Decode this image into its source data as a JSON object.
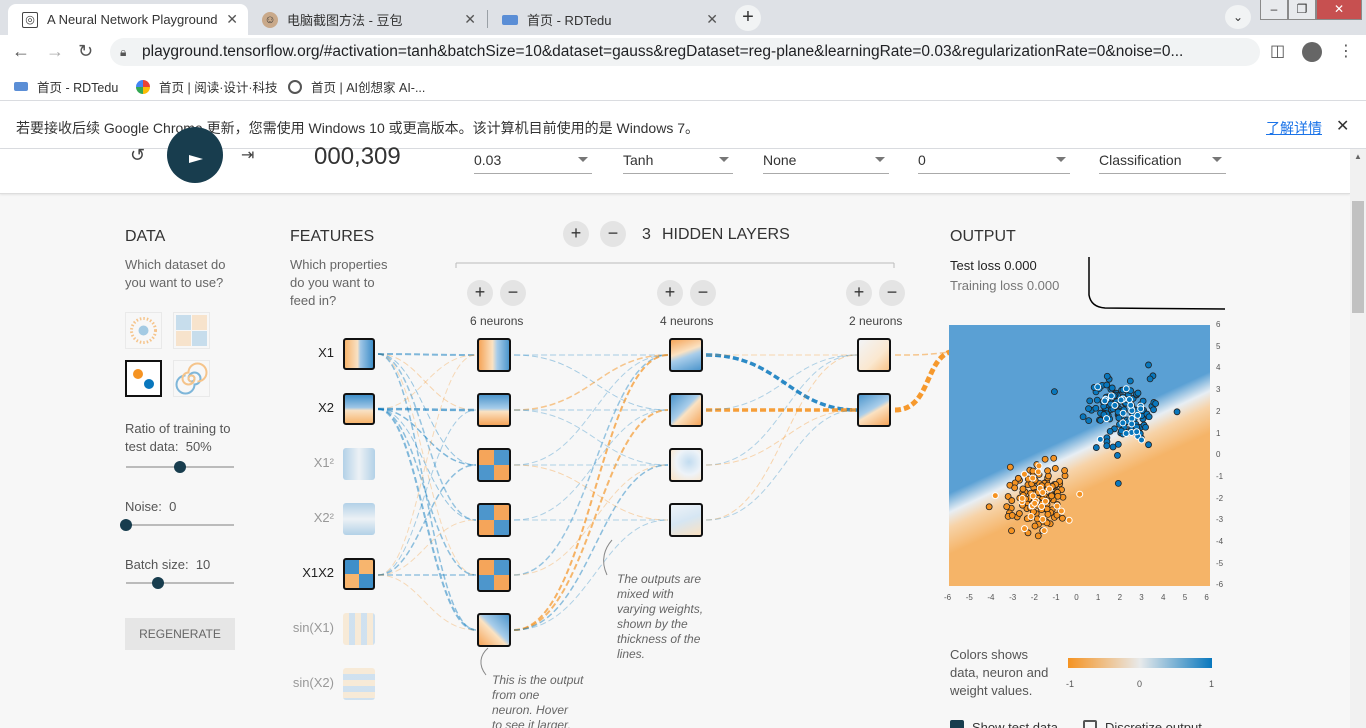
{
  "browser": {
    "tabs": [
      {
        "title": "A Neural Network Playground",
        "active": true
      },
      {
        "title": "电脑截图方法 - 豆包",
        "active": false
      },
      {
        "title": "首页 - RDTedu",
        "active": false
      }
    ],
    "url": "playground.tensorflow.org/#activation=tanh&batchSize=10&dataset=gauss&regDataset=reg-plane&learningRate=0.03&regularizationRate=0&noise=0...",
    "bookmarks": [
      "首页 - RDTedu",
      "首页 | 阅读·设计·科技",
      "首页 | AI创想家 AI-..."
    ],
    "infobar_text": "若要接收后续 Google Chrome 更新，您需使用 Windows 10 或更高版本。该计算机目前使用的是 Windows 7。",
    "infobar_link": "了解详情"
  },
  "top": {
    "epoch": "000,309",
    "learning_rate": "0.03",
    "activation": "Tanh",
    "regularization": "None",
    "reg_rate": "0",
    "problem_type": "Classification"
  },
  "data_panel": {
    "title": "DATA",
    "subtitle": "Which dataset do you want to use?",
    "ratio_label": "Ratio of training to test data:",
    "ratio_value": "50%",
    "ratio_fraction": 0.5,
    "noise_label": "Noise:",
    "noise_value": "0",
    "noise_fraction": 0,
    "batch_label": "Batch size:",
    "batch_value": "10",
    "batch_fraction": 0.3,
    "regenerate": "REGENERATE"
  },
  "features_panel": {
    "title": "FEATURES",
    "subtitle": "Which properties do you want to feed in?",
    "features": [
      {
        "label": "X1",
        "active": true
      },
      {
        "label": "X2",
        "active": true
      },
      {
        "label": "X1²",
        "active": false
      },
      {
        "label": "X2²",
        "active": false
      },
      {
        "label": "X1X2",
        "active": true
      },
      {
        "label": "sin(X1)",
        "active": false
      },
      {
        "label": "sin(X2)",
        "active": false
      }
    ]
  },
  "network": {
    "hidden_count": "3",
    "hidden_label": "HIDDEN LAYERS",
    "layers": [
      {
        "label": "6 neurons"
      },
      {
        "label": "4 neurons"
      },
      {
        "label": "2 neurons"
      }
    ],
    "anno_weights": [
      "The outputs are",
      "mixed with",
      "varying weights,",
      "shown by the",
      "thickness of the",
      "lines."
    ],
    "anno_neuron": [
      "This is the output",
      "from one",
      "neuron. Hover",
      "to see it larger."
    ]
  },
  "output_panel": {
    "title": "OUTPUT",
    "test_loss_label": "Test loss",
    "test_loss": "0.000",
    "training_loss_label": "Training loss",
    "training_loss": "0.000",
    "legend_text": [
      "Colors shows",
      "data, neuron and",
      "weight values."
    ],
    "legend_ticks": [
      "-1",
      "0",
      "1"
    ],
    "x_ticks": [
      "-6",
      "-5",
      "-4",
      "-3",
      "-2",
      "-1",
      "0",
      "1",
      "2",
      "3",
      "4",
      "5",
      "6"
    ],
    "y_ticks": [
      "6",
      "5",
      "4",
      "3",
      "2",
      "1",
      "0",
      "-1",
      "-2",
      "-3",
      "-4",
      "-5",
      "-6"
    ],
    "show_test_label": "Show test data",
    "discretize_label": "Discretize output"
  },
  "colors": {
    "orange": "#f59322",
    "blue": "#0877bd",
    "dark": "#183d4e"
  }
}
